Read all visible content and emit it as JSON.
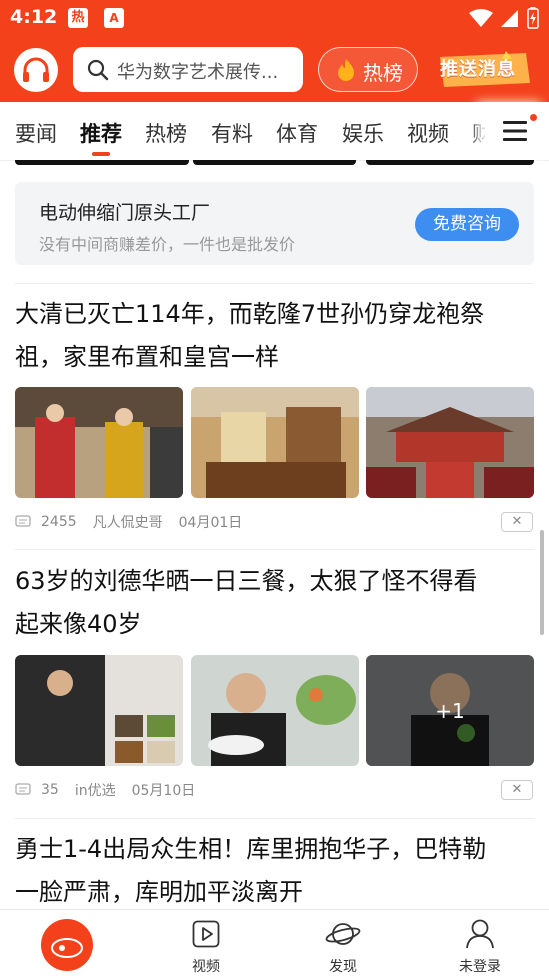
{
  "status_bar": {
    "time": "4:12",
    "badge_hot": "热",
    "badge_a": "A",
    "icons": [
      "wifi-icon",
      "signal-icon",
      "battery-icon"
    ]
  },
  "header": {
    "logo_icon": "headphones-icon",
    "search_placeholder": "华为数字艺术展传...",
    "search_icon": "search-icon",
    "hot_label": "热榜",
    "hot_icon": "flame-icon",
    "push_label": "推送消息",
    "brand_color": "#f3411b"
  },
  "tabs": {
    "items": [
      {
        "label": "要闻"
      },
      {
        "label": "推荐",
        "active": true
      },
      {
        "label": "热榜"
      },
      {
        "label": "有料"
      },
      {
        "label": "体育"
      },
      {
        "label": "娱乐"
      },
      {
        "label": "视频"
      },
      {
        "label": "财"
      }
    ],
    "menu_icon": "hamburger-menu-icon"
  },
  "ad": {
    "title": "电动伸缩门原头工厂",
    "subtitle": "没有中间商赚差价，一件也是批发价",
    "button": "免费咨询",
    "button_color": "#3d8ef0"
  },
  "articles": [
    {
      "headline_line1": "大清已灭亡114年，而乾隆7世孙仍穿龙袍祭",
      "headline_line2": "祖，家里布置和皇宫一样",
      "comments": "2455",
      "source": "凡人侃史哥",
      "date": "04月01日"
    },
    {
      "headline_line1": "63岁的刘德华晒一日三餐，太狠了怪不得看",
      "headline_line2": "起来像40岁",
      "extra_count": "+1",
      "comments": "35",
      "source": "in优选",
      "date": "05月10日"
    },
    {
      "headline_line1": "勇士1-4出局众生相！库里拥抱华子，巴特勒",
      "headline_line2": "一脸严肃，库明加平淡离开"
    }
  ],
  "bottom_nav": {
    "home_logo": "sina",
    "items": [
      {
        "label": "视频",
        "icon": "play-icon"
      },
      {
        "label": "发现",
        "icon": "planet-icon"
      },
      {
        "label": "未登录",
        "icon": "user-icon"
      }
    ]
  }
}
